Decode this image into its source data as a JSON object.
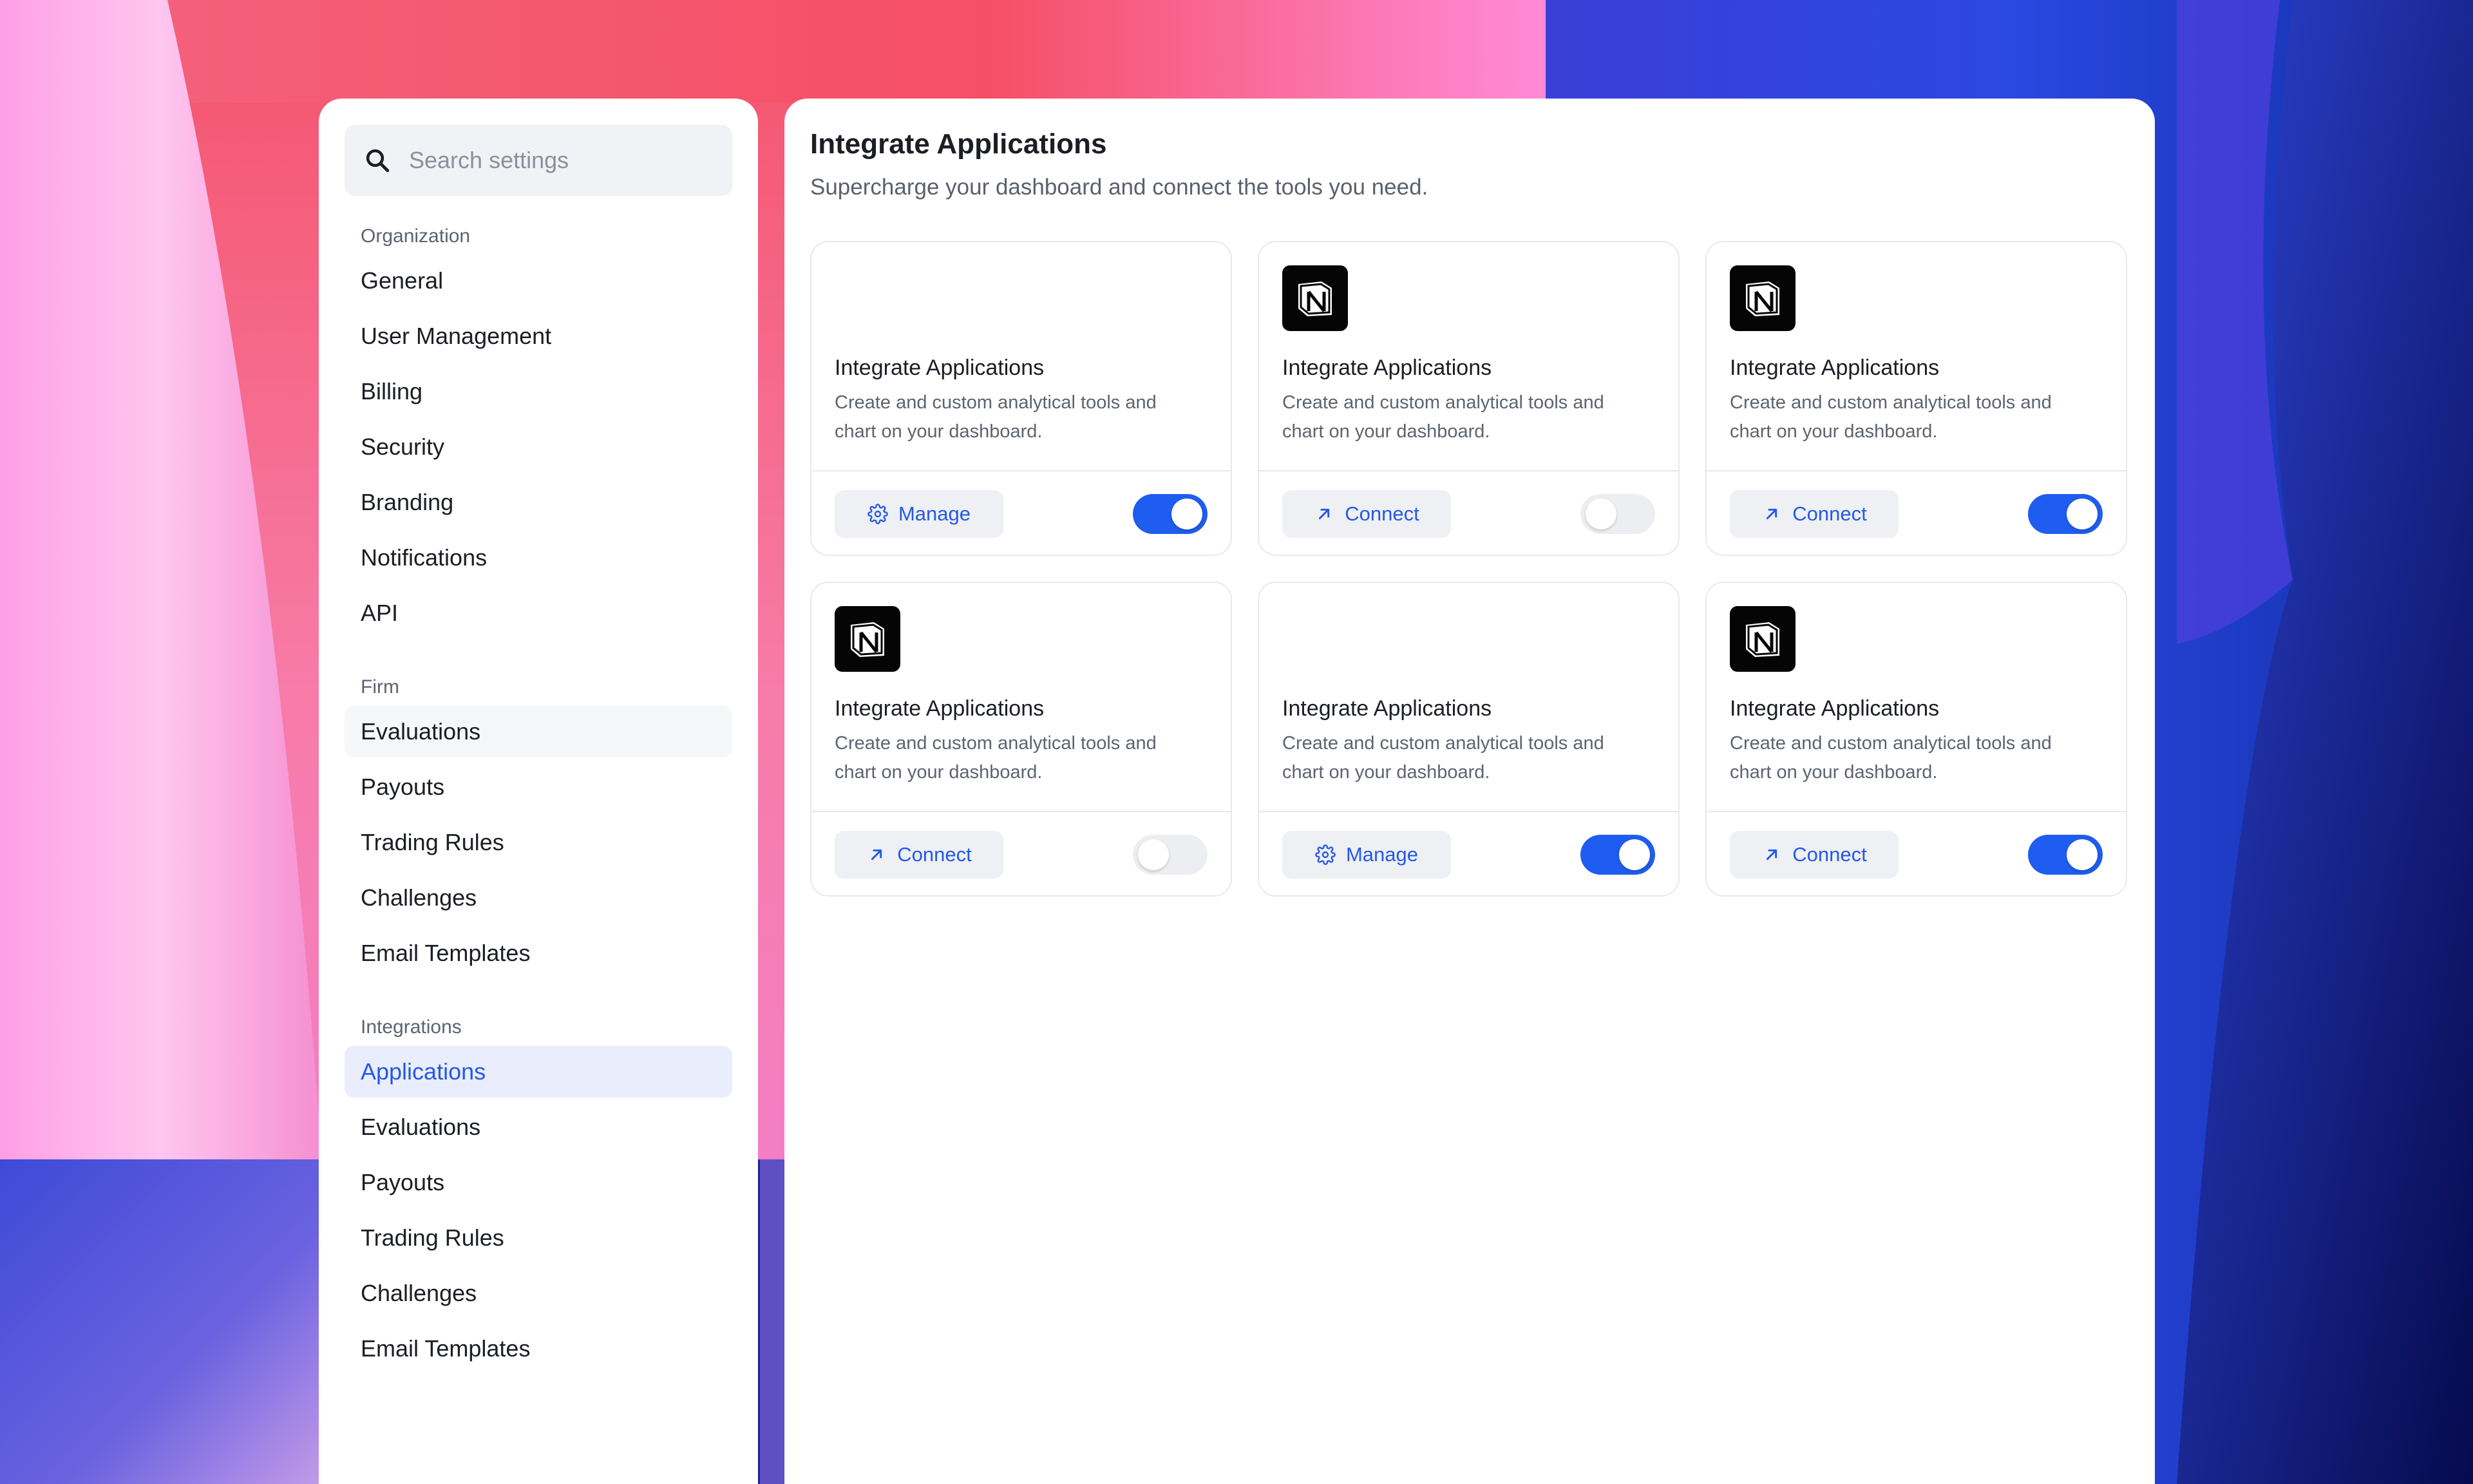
{
  "sidebar": {
    "search": {
      "placeholder": "Search settings",
      "icon": "search-icon"
    },
    "groups": [
      {
        "label": "Organization",
        "items": [
          {
            "label": "General"
          },
          {
            "label": "User Management"
          },
          {
            "label": "Billing"
          },
          {
            "label": "Security"
          },
          {
            "label": "Branding"
          },
          {
            "label": "Notifications"
          },
          {
            "label": "API"
          }
        ]
      },
      {
        "label": "Firm",
        "items": [
          {
            "label": "Evaluations"
          },
          {
            "label": "Payouts"
          },
          {
            "label": "Trading Rules"
          },
          {
            "label": "Challenges"
          },
          {
            "label": "Email Templates"
          }
        ]
      },
      {
        "label": "Integrations",
        "items": [
          {
            "label": "Applications"
          },
          {
            "label": "Evaluations"
          },
          {
            "label": "Payouts"
          },
          {
            "label": "Trading Rules"
          },
          {
            "label": "Challenges"
          },
          {
            "label": "Email Templates"
          }
        ]
      }
    ],
    "active_item": "Integrations / Applications",
    "hovered_item": "Firm / Evaluations"
  },
  "main": {
    "title": "Integrate Applications",
    "subtitle": "Supercharge your dashboard and connect the tools you need.",
    "cards": [
      {
        "logo": "none",
        "title": "Integrate Applications",
        "description": "Create and custom analytical tools and chart on your dashboard.",
        "button_label": "Manage",
        "button_icon": "gear-icon",
        "enabled": true
      },
      {
        "logo": "notion-logo",
        "title": "Integrate Applications",
        "description": "Create and custom analytical tools and chart on your dashboard.",
        "button_label": "Connect",
        "button_icon": "arrow-up-right-icon",
        "enabled": false
      },
      {
        "logo": "notion-logo",
        "title": "Integrate Applications",
        "description": "Create and custom analytical tools and chart on your dashboard.",
        "button_label": "Connect",
        "button_icon": "arrow-up-right-icon",
        "enabled": true
      },
      {
        "logo": "notion-logo",
        "title": "Integrate Applications",
        "description": "Create and custom analytical tools and chart on your dashboard.",
        "button_label": "Connect",
        "button_icon": "arrow-up-right-icon",
        "enabled": false
      },
      {
        "logo": "none",
        "title": "Integrate Applications",
        "description": "Create and custom analytical tools and chart on your dashboard.",
        "button_label": "Manage",
        "button_icon": "gear-icon",
        "enabled": true
      },
      {
        "logo": "notion-logo",
        "title": "Integrate Applications",
        "description": "Create and custom analytical tools and chart on your dashboard.",
        "button_label": "Connect",
        "button_icon": "arrow-up-right-icon",
        "enabled": true
      }
    ]
  },
  "colors": {
    "accent": "#2458e8",
    "toggle_on": "#1f5cf0",
    "toggle_off": "#edeef2",
    "active_nav_bg": "#eaeefc",
    "panel_bg": "#ffffff"
  }
}
